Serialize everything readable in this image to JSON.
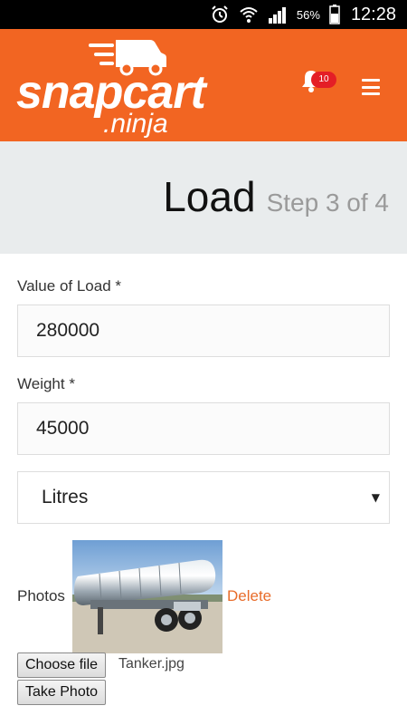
{
  "status_bar": {
    "battery_percent": "56%",
    "time": "12:28",
    "icons": [
      "alarm-icon",
      "wifi-icon",
      "signal-icon",
      "battery-icon"
    ]
  },
  "header": {
    "brand": "snapcart",
    "brand_sub": ".ninja",
    "notifications_count": "10",
    "accent_color": "#f26522"
  },
  "page": {
    "title": "Load",
    "step": "Step 3 of 4"
  },
  "form": {
    "value_label": "Value of Load *",
    "value_value": "280000",
    "weight_label": "Weight *",
    "weight_value": "45000",
    "unit_selected": "Litres",
    "photos_label": "Photos",
    "delete_label": "Delete",
    "choose_file_label": "Choose file",
    "file_name": "Tanker.jpg",
    "take_photo_label": "Take Photo"
  }
}
